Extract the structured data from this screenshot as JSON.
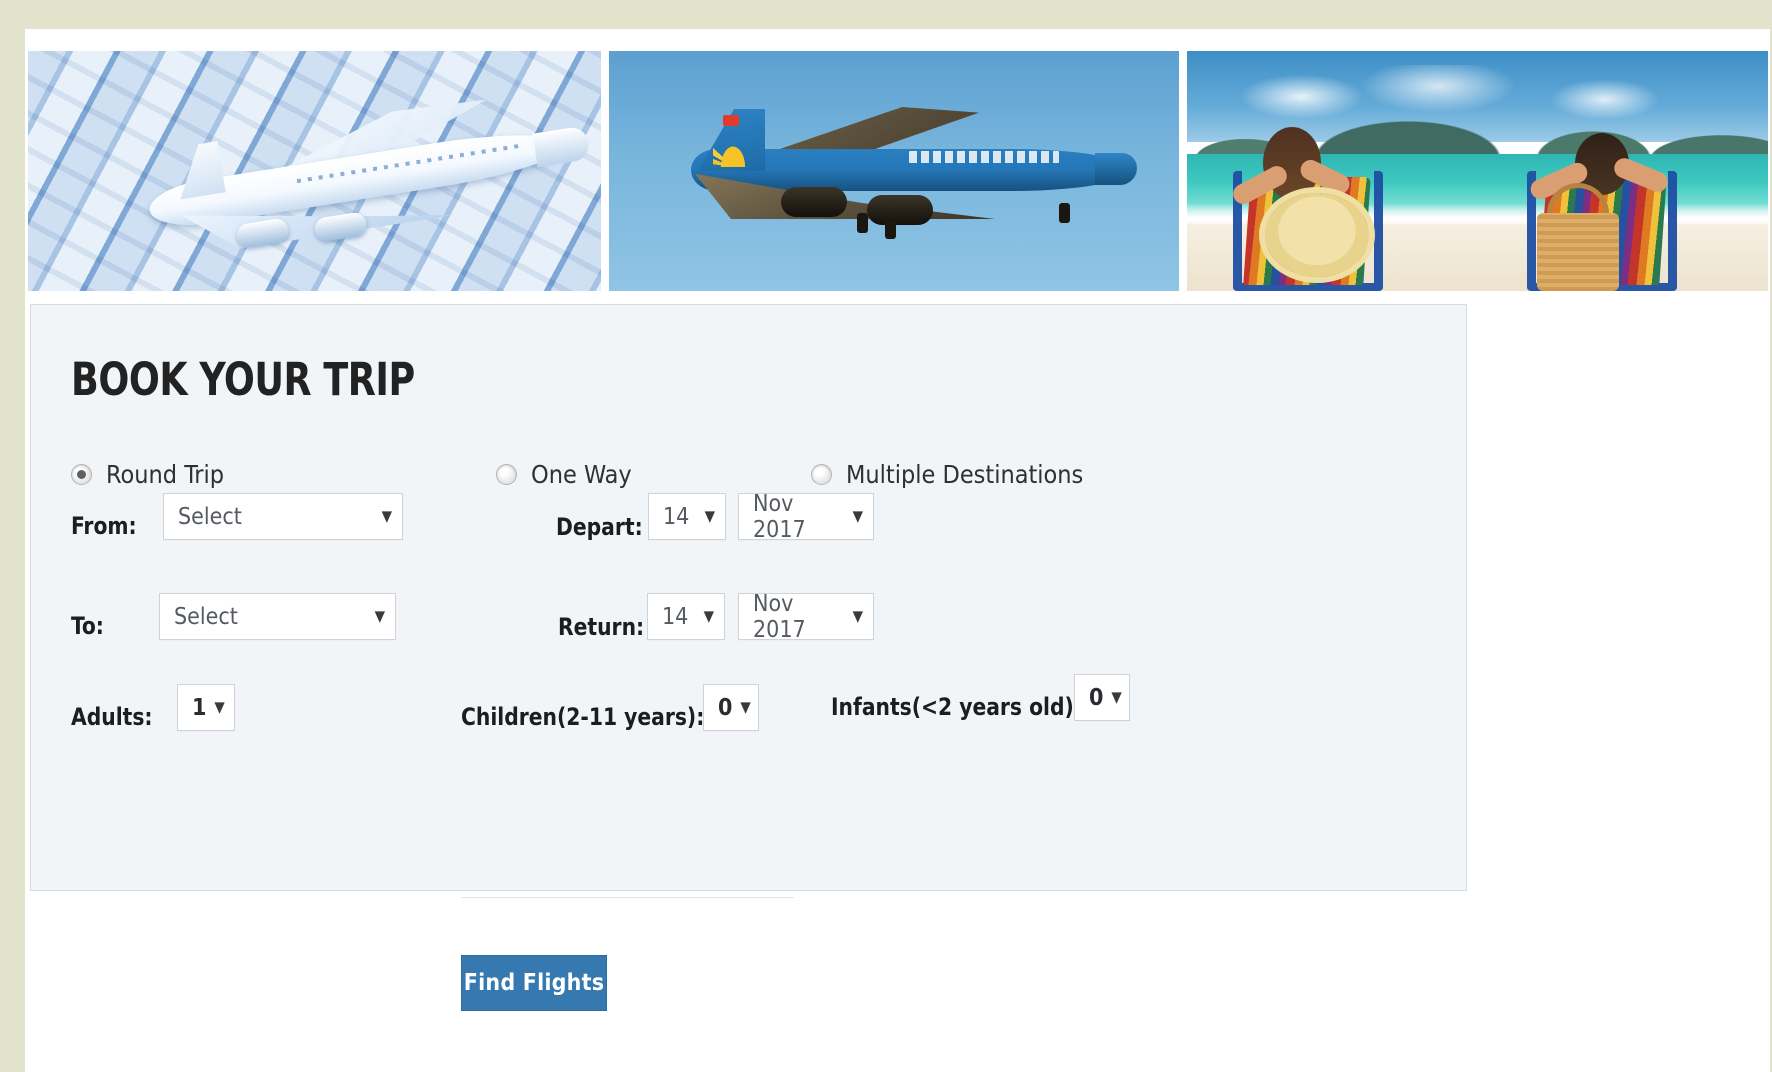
{
  "page": {
    "background_color": "#e2e3cd",
    "content_background": "#ffffff"
  },
  "banners": [
    {
      "name": "model-airplane-on-keyboard",
      "alt": "Model airplane resting on a computer keyboard, blue tint"
    },
    {
      "name": "vietnam-airlines-aircraft",
      "alt": "Vietnam Airlines wide-body jet in flight against blue sky"
    },
    {
      "name": "beach-couple-relaxing",
      "alt": "Couple relaxing in striped beach chairs facing turquoise sea"
    }
  ],
  "booking_form": {
    "title": "BOOK YOUR TRIP",
    "panel_color": "#f2f5f8",
    "border_color": "#d8dbdf",
    "trip_types": [
      {
        "label": "Round Trip",
        "selected": true
      },
      {
        "label": "One Way",
        "selected": false
      },
      {
        "label": "Multiple Destinations",
        "selected": false
      }
    ],
    "from": {
      "label": "From:",
      "value": "Select"
    },
    "to": {
      "label": "To:",
      "value": "Select"
    },
    "depart": {
      "label": "Depart:",
      "day": "14",
      "month": "Nov 2017"
    },
    "return": {
      "label": "Return:",
      "day": "14",
      "month": "Nov 2017"
    },
    "adults": {
      "label": "Adults:",
      "value": "1"
    },
    "children": {
      "label": "Children(2-11 years):",
      "value": "0"
    },
    "infants": {
      "label": "Infants(<2 years old):",
      "value": "0"
    },
    "submit": {
      "label": "Find Flights",
      "color": "#3579b0"
    },
    "caret_glyph": "▼"
  }
}
